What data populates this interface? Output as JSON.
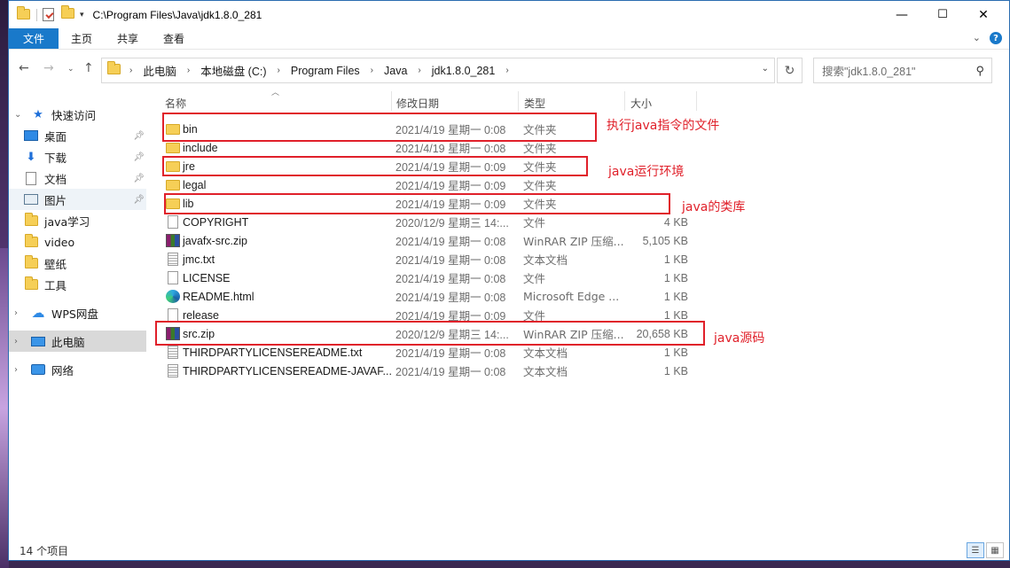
{
  "window": {
    "title_path": "C:\\Program Files\\Java\\jdk1.8.0_281",
    "controls": {
      "minimize": "—",
      "maximize": "☐",
      "close": "✕"
    }
  },
  "ribbon": {
    "tabs": [
      "文件",
      "主页",
      "共享",
      "查看"
    ],
    "expand": "⌄",
    "help": "?"
  },
  "address": {
    "crumbs": [
      "此电脑",
      "本地磁盘 (C:)",
      "Program Files",
      "Java",
      "jdk1.8.0_281"
    ],
    "search_placeholder": "搜索\"jdk1.8.0_281\""
  },
  "sidebar": {
    "items": [
      {
        "label": "快速访问",
        "icon": "star-icon",
        "chevron": "⌄"
      },
      {
        "label": "桌面",
        "icon": "desktop-icon",
        "pinned": true
      },
      {
        "label": "下载",
        "icon": "download-icon",
        "pinned": true
      },
      {
        "label": "文档",
        "icon": "document-icon",
        "pinned": true
      },
      {
        "label": "图片",
        "icon": "pictures-icon",
        "pinned": true
      },
      {
        "label": "java学习",
        "icon": "folder-icon"
      },
      {
        "label": "video",
        "icon": "folder-icon"
      },
      {
        "label": "壁纸",
        "icon": "folder-icon"
      },
      {
        "label": "工具",
        "icon": "folder-icon"
      },
      {
        "label": "WPS网盘",
        "icon": "cloud-icon",
        "chevron": "›"
      },
      {
        "label": "此电脑",
        "icon": "computer-icon",
        "chevron": "›",
        "selected": true
      },
      {
        "label": "网络",
        "icon": "network-icon",
        "chevron": "›"
      }
    ]
  },
  "columns": {
    "name": "名称",
    "date": "修改日期",
    "type": "类型",
    "size": "大小"
  },
  "files": [
    {
      "name": "bin",
      "date": "2021/4/19 星期一 0:08",
      "type": "文件夹",
      "size": "",
      "icon": "folder-icon"
    },
    {
      "name": "include",
      "date": "2021/4/19 星期一 0:08",
      "type": "文件夹",
      "size": "",
      "icon": "folder-icon"
    },
    {
      "name": "jre",
      "date": "2021/4/19 星期一 0:09",
      "type": "文件夹",
      "size": "",
      "icon": "folder-icon"
    },
    {
      "name": "legal",
      "date": "2021/4/19 星期一 0:09",
      "type": "文件夹",
      "size": "",
      "icon": "folder-icon"
    },
    {
      "name": "lib",
      "date": "2021/4/19 星期一 0:09",
      "type": "文件夹",
      "size": "",
      "icon": "folder-icon"
    },
    {
      "name": "COPYRIGHT",
      "date": "2020/12/9 星期三 14:...",
      "type": "文件",
      "size": "4 KB",
      "icon": "file-icon"
    },
    {
      "name": "javafx-src.zip",
      "date": "2021/4/19 星期一 0:08",
      "type": "WinRAR ZIP 压缩...",
      "size": "5,105 KB",
      "icon": "zip-icon"
    },
    {
      "name": "jmc.txt",
      "date": "2021/4/19 星期一 0:08",
      "type": "文本文档",
      "size": "1 KB",
      "icon": "text-file-icon"
    },
    {
      "name": "LICENSE",
      "date": "2021/4/19 星期一 0:08",
      "type": "文件",
      "size": "1 KB",
      "icon": "file-icon"
    },
    {
      "name": "README.html",
      "date": "2021/4/19 星期一 0:08",
      "type": "Microsoft Edge ...",
      "size": "1 KB",
      "icon": "edge-icon"
    },
    {
      "name": "release",
      "date": "2021/4/19 星期一 0:09",
      "type": "文件",
      "size": "1 KB",
      "icon": "file-icon"
    },
    {
      "name": "src.zip",
      "date": "2020/12/9 星期三 14:...",
      "type": "WinRAR ZIP 压缩...",
      "size": "20,658 KB",
      "icon": "zip-icon"
    },
    {
      "name": "THIRDPARTYLICENSEREADME.txt",
      "date": "2021/4/19 星期一 0:08",
      "type": "文本文档",
      "size": "1 KB",
      "icon": "text-file-icon"
    },
    {
      "name": "THIRDPARTYLICENSEREADME-JAVAF...",
      "date": "2021/4/19 星期一 0:08",
      "type": "文本文档",
      "size": "1 KB",
      "icon": "text-file-icon"
    }
  ],
  "annotations": {
    "bin": "执行java指令的文件",
    "jre": "java运行环境",
    "lib": "java的类库",
    "src": "java源码",
    "color": "#e0202a"
  },
  "status": {
    "count": "14 个项目"
  }
}
